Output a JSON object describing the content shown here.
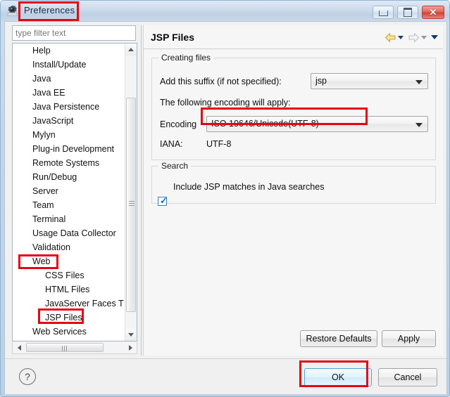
{
  "window": {
    "title": "Preferences",
    "icon": "preferences-window-icon",
    "controls": {
      "minimize": "Minimize",
      "maximize": "Maximize",
      "close": "Close"
    }
  },
  "filter": {
    "placeholder": "type filter text",
    "value": ""
  },
  "tree": {
    "items": [
      {
        "label": "Help",
        "level": 0
      },
      {
        "label": "Install/Update",
        "level": 0
      },
      {
        "label": "Java",
        "level": 0
      },
      {
        "label": "Java EE",
        "level": 0
      },
      {
        "label": "Java Persistence",
        "level": 0
      },
      {
        "label": "JavaScript",
        "level": 0
      },
      {
        "label": "Mylyn",
        "level": 0
      },
      {
        "label": "Plug-in Development",
        "level": 0
      },
      {
        "label": "Remote Systems",
        "level": 0
      },
      {
        "label": "Run/Debug",
        "level": 0
      },
      {
        "label": "Server",
        "level": 0
      },
      {
        "label": "Team",
        "level": 0
      },
      {
        "label": "Terminal",
        "level": 0
      },
      {
        "label": "Usage Data Collector",
        "level": 0
      },
      {
        "label": "Validation",
        "level": 0
      },
      {
        "label": "Web",
        "level": 0
      },
      {
        "label": "CSS Files",
        "level": 1
      },
      {
        "label": "HTML Files",
        "level": 1
      },
      {
        "label": "JavaServer Faces T",
        "level": 1
      },
      {
        "label": "JSP Files",
        "level": 1
      },
      {
        "label": "Web Services",
        "level": 0
      }
    ]
  },
  "pane": {
    "title": "JSP Files",
    "nav": {
      "back": "back-arrow-icon",
      "back_menu": "back-dropdown-icon",
      "forward": "forward-arrow-icon",
      "forward_menu": "forward-dropdown-icon",
      "view_menu": "view-menu-dropdown-icon"
    },
    "creating_files": {
      "group_title": "Creating files",
      "suffix_label": "Add this suffix (if not specified):",
      "suffix_value": "jsp",
      "encoding_note": "The following encoding will apply:",
      "encoding_label": "Encoding",
      "encoding_value": "ISO 10646/Unicode(UTF-8)",
      "iana_label": "IANA:",
      "iana_value": "UTF-8"
    },
    "search": {
      "group_title": "Search",
      "checkbox_label": "Include JSP matches in Java searches",
      "checkbox_checked": true,
      "checkbox_glyph": "✓"
    },
    "restore_defaults_label": "Restore Defaults",
    "apply_label": "Apply"
  },
  "footer": {
    "help_glyph": "?",
    "ok_label": "OK",
    "cancel_label": "Cancel"
  },
  "annotations": {
    "color": "#e30613",
    "boxes": [
      "title-preferences",
      "encoding-combo",
      "tree-web",
      "tree-jsp-files",
      "ok-button"
    ]
  }
}
